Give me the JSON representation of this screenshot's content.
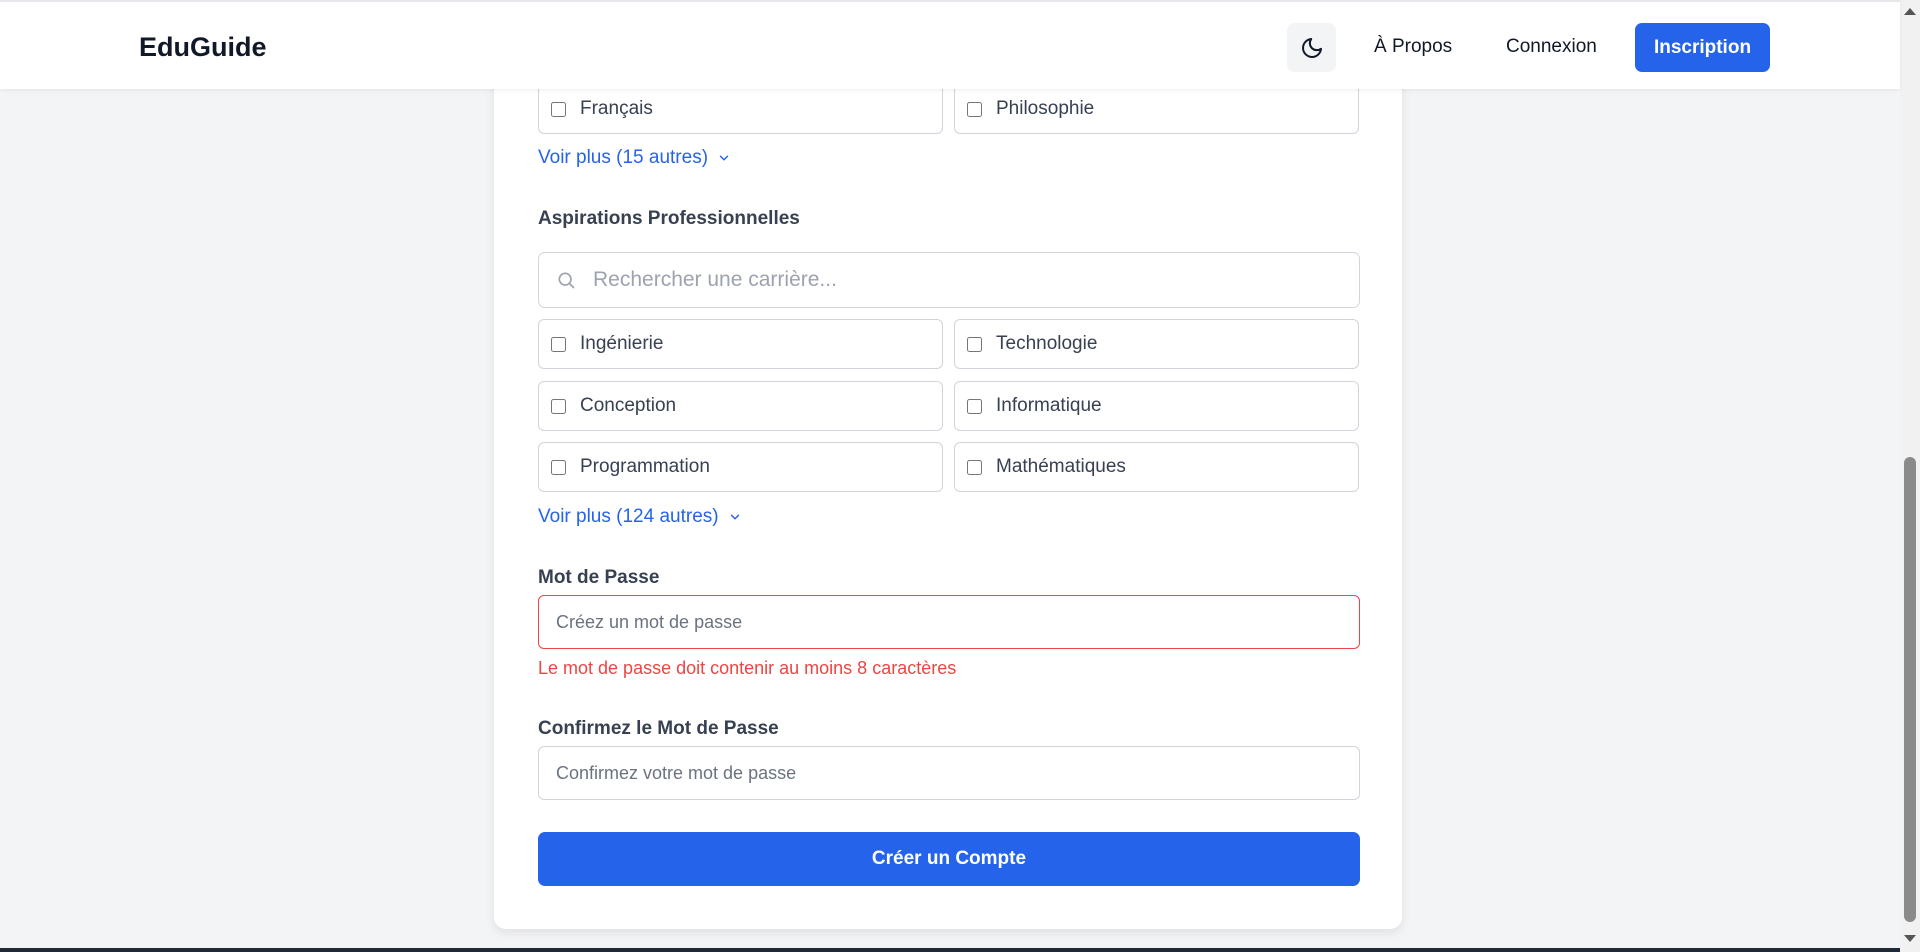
{
  "header": {
    "brand": "EduGuide",
    "nav": {
      "about": "À Propos",
      "login": "Connexion",
      "signup": "Inscription"
    }
  },
  "subjects": {
    "visible_items": [
      "Français",
      "Philosophie"
    ],
    "see_more": "Voir plus (15 autres)"
  },
  "careers": {
    "label": "Aspirations Professionnelles",
    "search_placeholder": "Rechercher une carrière...",
    "items": [
      "Ingénierie",
      "Technologie",
      "Conception",
      "Informatique",
      "Programmation",
      "Mathématiques"
    ],
    "see_more": "Voir plus (124 autres)"
  },
  "password": {
    "label": "Mot de Passe",
    "placeholder": "Créez un mot de passe",
    "error": "Le mot de passe doit contenir au moins 8 caractères"
  },
  "confirm_password": {
    "label": "Confirmez le Mot de Passe",
    "placeholder": "Confirmez votre mot de passe"
  },
  "submit_label": "Créer un Compte",
  "colors": {
    "primary": "#2563eb",
    "error": "#ef4444",
    "background": "#f3f4f6"
  }
}
